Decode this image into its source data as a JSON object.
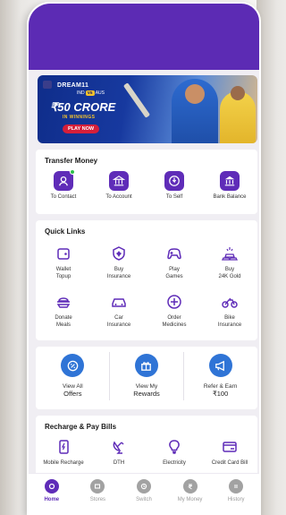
{
  "banner": {
    "brand": "DREAM11",
    "match_left": "IND",
    "match_vs": "vs",
    "match_right": "AUS",
    "headline": "₹50 CRORE",
    "subline": "IN WINNINGS",
    "cta": "PLAY NOW"
  },
  "transfer": {
    "title": "Transfer Money",
    "items": [
      {
        "label": "To Contact",
        "icon": "contact-icon"
      },
      {
        "label": "To Account",
        "icon": "bank-icon"
      },
      {
        "label": "To Self",
        "icon": "self-transfer-icon"
      },
      {
        "label": "Bank Balance",
        "icon": "bank-balance-icon"
      }
    ]
  },
  "quick_links": {
    "title": "Quick Links",
    "items": [
      {
        "label_1": "Wallet",
        "label_2": "Topup",
        "icon": "wallet-icon"
      },
      {
        "label_1": "Buy",
        "label_2": "Insurance",
        "icon": "insurance-icon"
      },
      {
        "label_1": "Play",
        "label_2": "Games",
        "icon": "gamepad-icon"
      },
      {
        "label_1": "Buy",
        "label_2": "24K Gold",
        "icon": "gold-icon"
      },
      {
        "label_1": "Donate",
        "label_2": "Meals",
        "icon": "donate-icon"
      },
      {
        "label_1": "Car",
        "label_2": "Insurance",
        "icon": "car-icon"
      },
      {
        "label_1": "Order",
        "label_2": "Medicines",
        "icon": "medicine-icon"
      },
      {
        "label_1": "Bike",
        "label_2": "Insurance",
        "icon": "bike-icon"
      }
    ]
  },
  "offers": {
    "items": [
      {
        "label_1": "View All",
        "label_2": "Offers",
        "icon": "offer-icon"
      },
      {
        "label_1": "View My",
        "label_2": "Rewards",
        "icon": "gift-icon"
      },
      {
        "label_1": "Refer & Earn",
        "label_2": "₹100",
        "icon": "megaphone-icon"
      }
    ]
  },
  "recharge": {
    "title": "Recharge & Pay Bills",
    "items": [
      {
        "label": "Mobile Recharge",
        "icon": "mobile-icon"
      },
      {
        "label": "DTH",
        "icon": "satellite-icon"
      },
      {
        "label": "Electricity",
        "icon": "bulb-icon"
      },
      {
        "label": "Credit Card Bill",
        "icon": "credit-card-icon"
      }
    ]
  },
  "nav": {
    "items": [
      {
        "label": "Home",
        "icon": "home-icon",
        "active": true
      },
      {
        "label": "Stores",
        "icon": "stores-icon",
        "active": false
      },
      {
        "label": "Switch",
        "icon": "switch-icon",
        "active": false
      },
      {
        "label": "My Money",
        "icon": "rupee-icon",
        "active": false
      },
      {
        "label": "History",
        "icon": "history-icon",
        "active": false
      }
    ]
  },
  "colors": {
    "brand_purple": "#5f2cb8",
    "header_purple": "#5c2bb4",
    "offer_blue": "#2f74d6"
  }
}
